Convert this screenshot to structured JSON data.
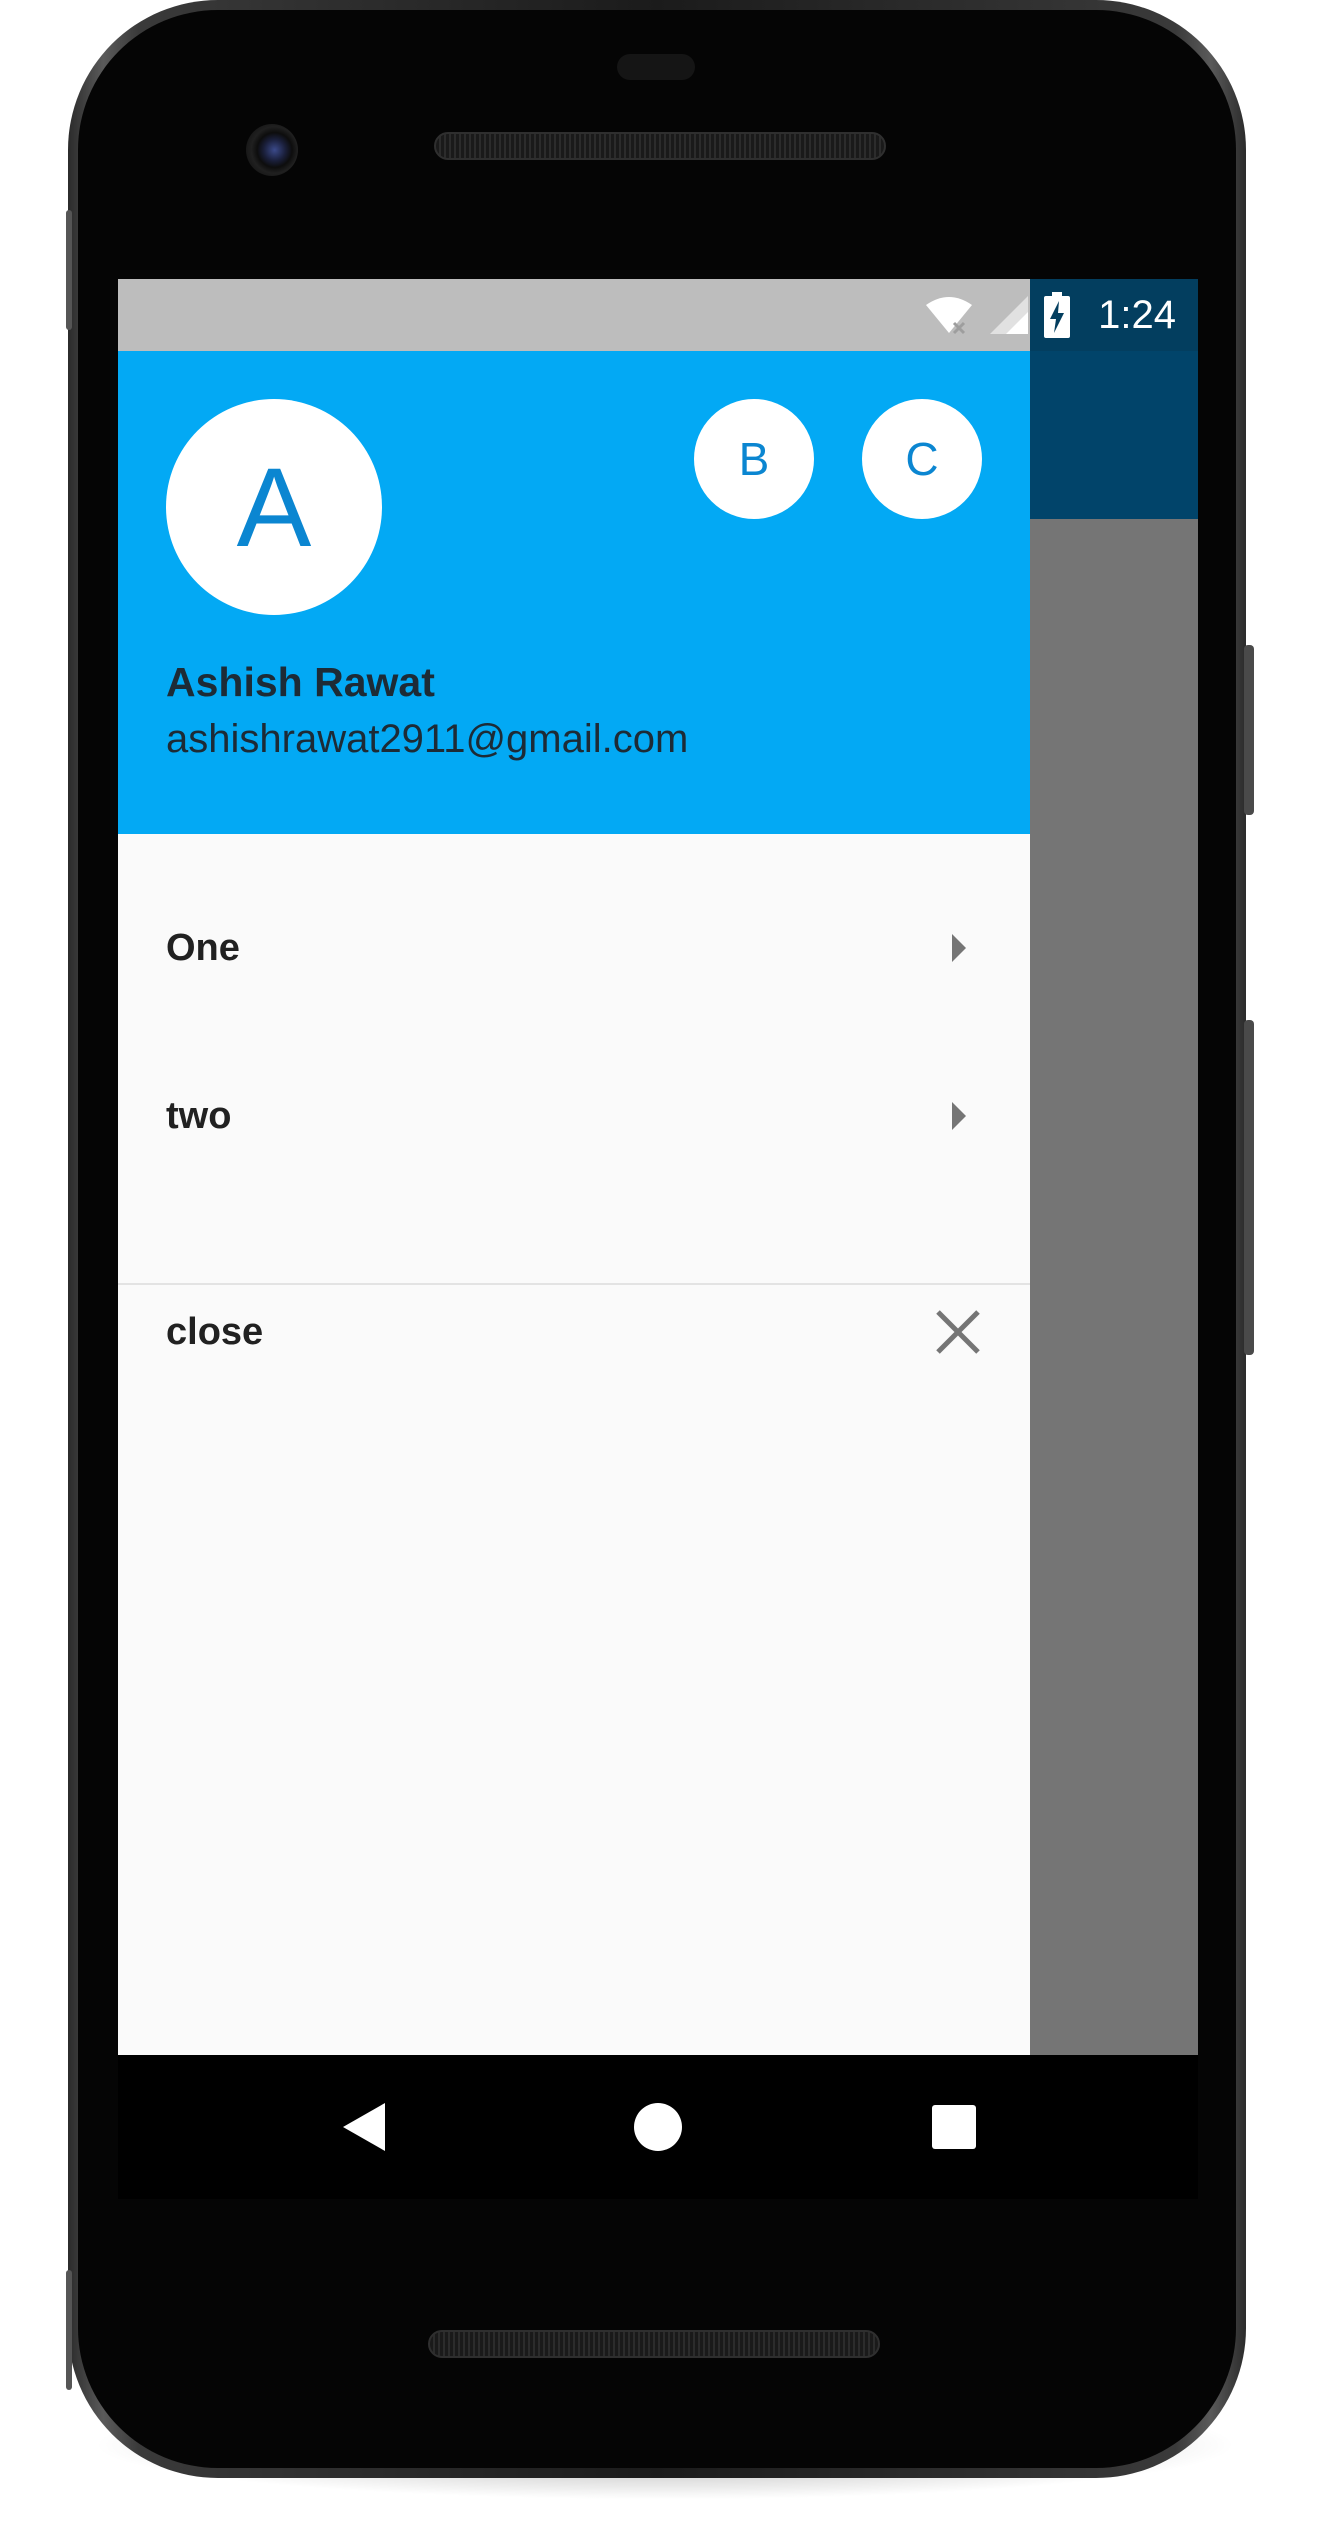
{
  "status_bar": {
    "time": "1:24",
    "icons": [
      "wifi-off-icon",
      "cell-signal-icon",
      "battery-charging-icon"
    ]
  },
  "drawer": {
    "header": {
      "current_account_initial": "A",
      "other_accounts": [
        "B",
        "C"
      ],
      "account_name": "Ashish Rawat",
      "account_email": "ashishrawat2911@gmail.com"
    },
    "items": [
      {
        "label": "One",
        "icon": "arrow-right-icon"
      },
      {
        "label": "two",
        "icon": "arrow-right-icon"
      },
      {
        "label": "close",
        "icon": "close-icon"
      }
    ]
  },
  "nav_bar": {
    "icons": [
      "back-icon",
      "home-icon",
      "recents-icon"
    ]
  },
  "colors": {
    "header_background": "#03a9f4",
    "app_bar": "#01446a",
    "scrim": "#757575",
    "avatar_text": "#0b86d1",
    "drawer_background": "#fafafa"
  }
}
